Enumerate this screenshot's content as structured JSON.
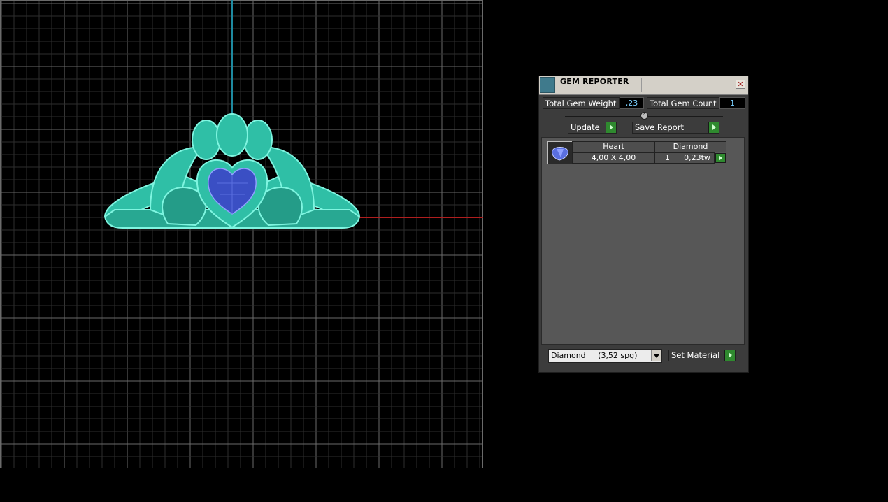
{
  "viewport": {
    "grid_color": "#5a5a5a",
    "model_color": "#3fe6c8",
    "gem_color": "#3a4fc4",
    "axis_x_color": "#b01e1e",
    "axis_y_color": "#1e8aa0"
  },
  "panel": {
    "title": "GEM REPORTER",
    "close_glyph": "✕",
    "total_weight_label": "Total Gem Weight",
    "total_weight_value": ",23",
    "total_count_label": "Total Gem Count",
    "total_count_value": "1",
    "update_label": "Update",
    "save_report_label": "Save Report",
    "gems": [
      {
        "thumb_icon": "heart-gem-icon",
        "shape": "Heart",
        "material": "Diamond",
        "size": "4,00 X 4,00",
        "count": "1",
        "weight": "0,23tw"
      }
    ],
    "material_selected": "Diamond     (3,52 spg)",
    "set_material_label": "Set Material",
    "accent_green": "#2f8a2f"
  }
}
